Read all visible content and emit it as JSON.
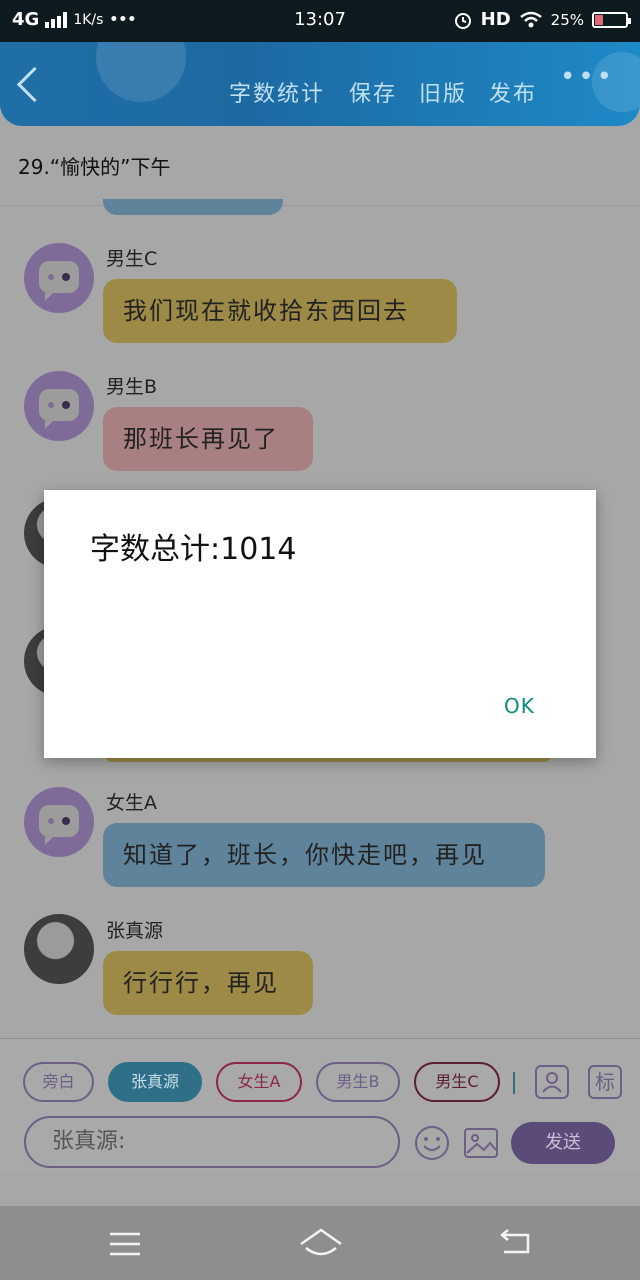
{
  "status": {
    "network": "4G",
    "speed": "1K/s",
    "dots": "•••",
    "time": "13:07",
    "hd": "HD",
    "battery": "25%",
    "battery_level": 0.25
  },
  "topbar": {
    "menu": [
      "字数统计",
      "保存",
      "旧版",
      "发布"
    ],
    "more": "•••"
  },
  "chapter_title": "29.“愉快的”下午",
  "messages": [
    {
      "sender": "男生C",
      "text": "我们现在就收拾东西回去"
    },
    {
      "sender": "男生B",
      "text": "那班长再见了"
    },
    {
      "sender": "女生A",
      "text": "知道了，班长，你快走吧，再见"
    },
    {
      "sender": "张真源",
      "text": "行行行，再见"
    }
  ],
  "roles": [
    "旁白",
    "张真源",
    "女生A",
    "男生B",
    "男生C"
  ],
  "role_icons": {
    "portrait": "person-icon",
    "tag": "标"
  },
  "input": {
    "placeholder": "张真源:"
  },
  "send_label": "发送",
  "dialog": {
    "message": "字数总计:1014",
    "ok": "OK"
  },
  "colors": {
    "accent_purple": "#5a4b79",
    "topbar_blue": "#1f6ea6",
    "dialog_ok": "#0e8a80"
  }
}
